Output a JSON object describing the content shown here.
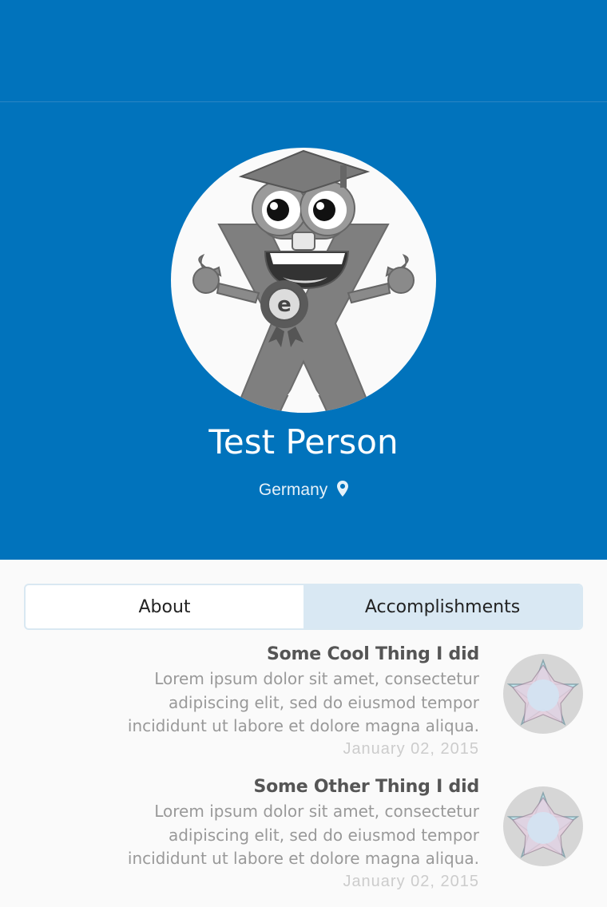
{
  "profile": {
    "name": "Test Person",
    "location": "Germany",
    "location_icon": "map-pin-icon",
    "avatar_badge_letter": "e"
  },
  "tabs": [
    {
      "label": "About",
      "active": false
    },
    {
      "label": "Accomplishments",
      "active": true
    }
  ],
  "accomplishments": [
    {
      "title": "Some Cool Thing I did",
      "description": "Lorem ipsum dolor sit amet, consectetur adipiscing elit, sed do eiusmod tempor incididunt ut labore et dolore magna aliqua.",
      "date": "January 02, 2015",
      "icon": "star-badge-icon"
    },
    {
      "title": "Some Other Thing I did",
      "description": "Lorem ipsum dolor sit amet, consectetur adipiscing elit, sed do eiusmod tempor incididunt ut labore et dolore magna aliqua.",
      "date": "January 02, 2015",
      "icon": "star-badge-icon"
    }
  ],
  "colors": {
    "header_blue": "#0173bc",
    "active_tab": "#d9e8f3",
    "tab_border": "#d9e8f2"
  }
}
